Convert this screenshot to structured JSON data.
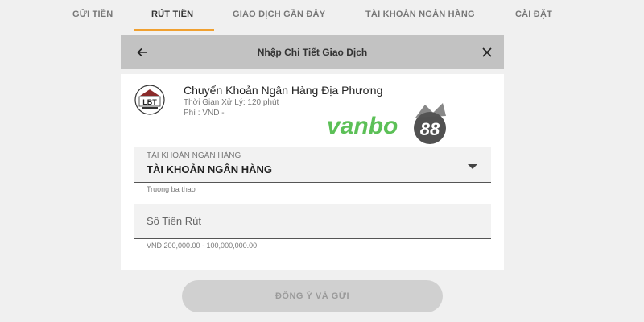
{
  "tabs": [
    {
      "label": "GỬI TIỀN"
    },
    {
      "label": "RÚT TIỀN"
    },
    {
      "label": "GIAO DỊCH GẦN ĐÂY"
    },
    {
      "label": "TÀI KHOẢN NGÂN HÀNG"
    },
    {
      "label": "CÀI ĐẶT"
    }
  ],
  "active_tab": "RÚT TIỀN",
  "colors": {
    "accent": "#f0a030",
    "header_bg": "#c2c2c2",
    "button_bg": "#d0d0d0",
    "watermark_green": "#3fb53a"
  },
  "dialog": {
    "title": "Nhập Chi Tiết Giao Dịch",
    "back_icon": "arrow-left-icon",
    "close_icon": "close-icon"
  },
  "method": {
    "logo_text": "LBT",
    "name": "Chuyển Khoản Ngân Hàng Địa Phương",
    "processing_time": "Thời Gian Xử Lý: 120 phút",
    "fee": "Phí : VND -"
  },
  "watermark": {
    "brand": "vanbo",
    "number": "88"
  },
  "bank_account": {
    "label": "TÀI KHOẢN NGÂN HÀNG",
    "value": "TÀI KHOẢN NGÂN HÀNG",
    "helper": "Truong ba thao"
  },
  "amount": {
    "placeholder": "Số Tiền Rút",
    "helper": "VND 200,000.00 - 100,000,000.00"
  },
  "submit_label": "ĐỒNG Ý VÀ GỬI"
}
